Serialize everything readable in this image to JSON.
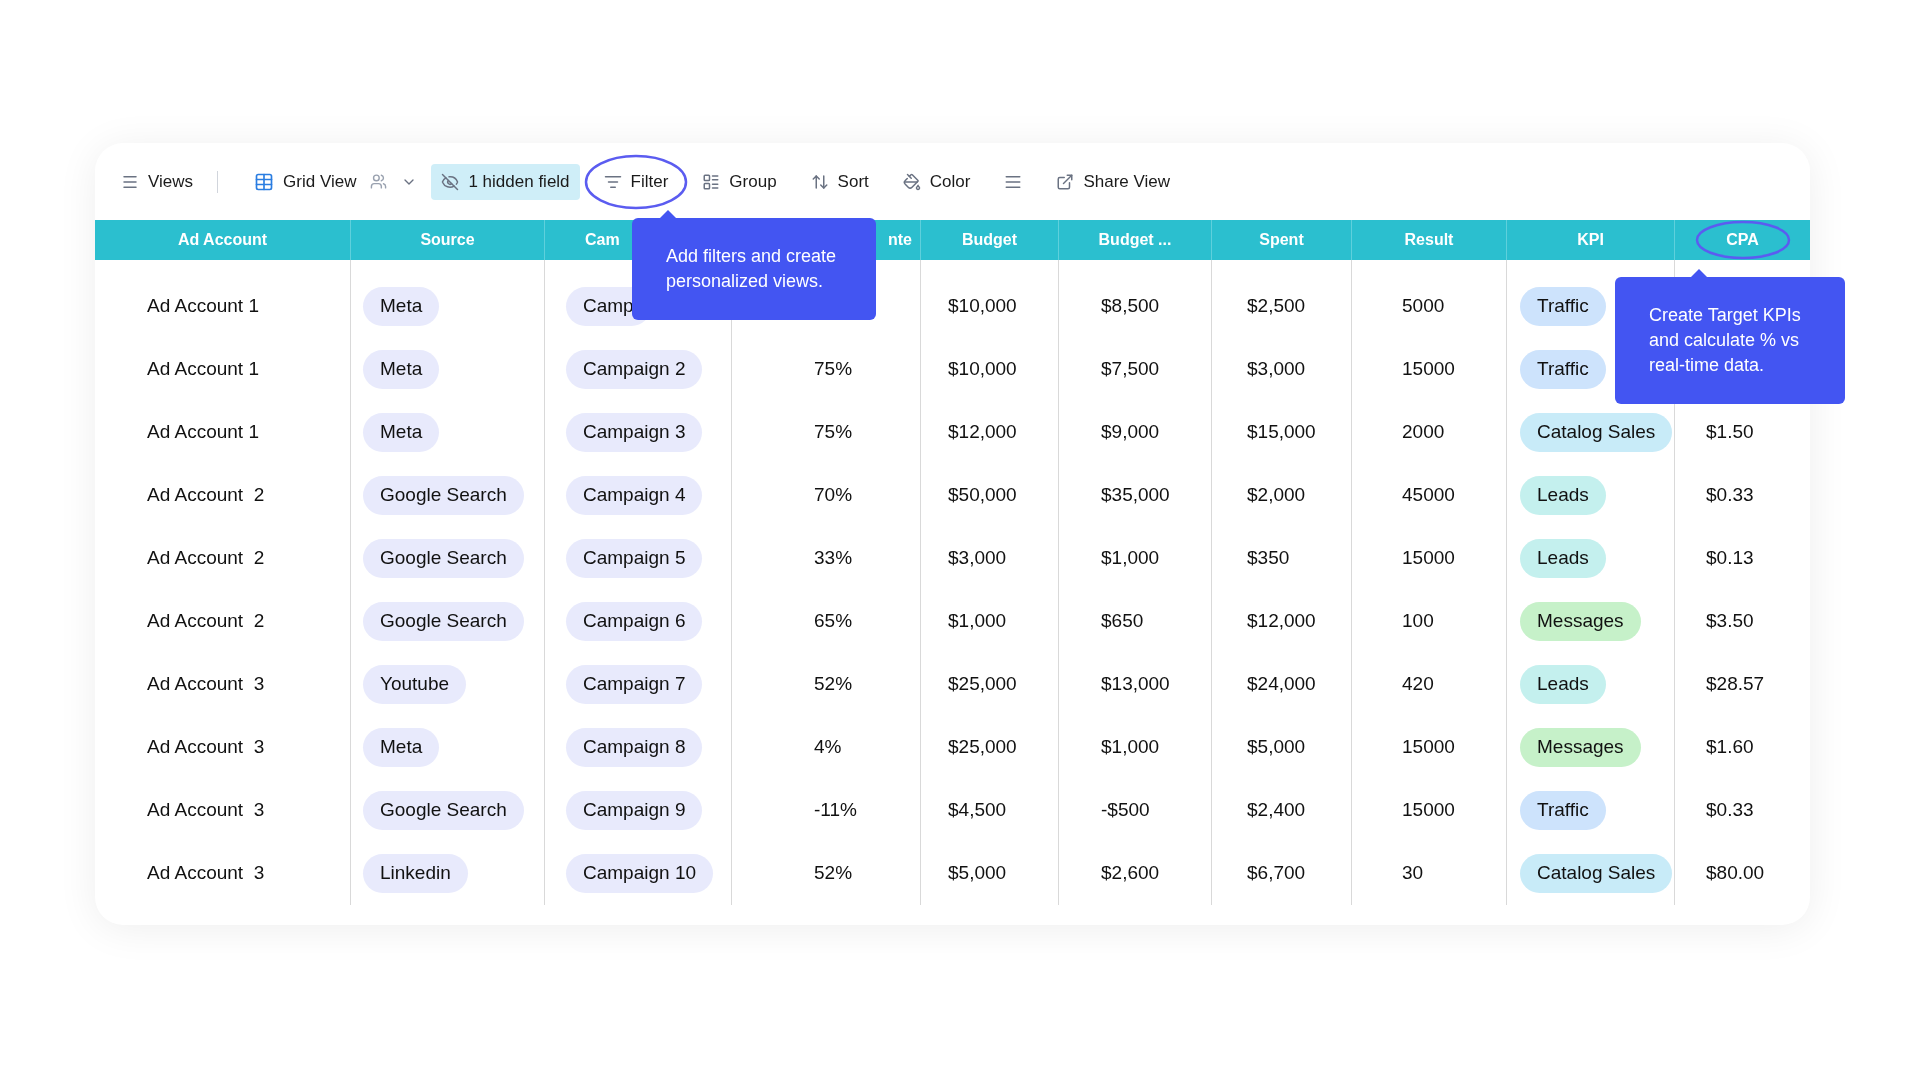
{
  "toolbar": [
    {
      "kind": "views",
      "label": "Views",
      "active": false
    },
    {
      "kind": "grid",
      "label": "Grid View",
      "active": false
    },
    {
      "kind": "hidden",
      "label": "1 hidden field",
      "active": true
    },
    {
      "kind": "filter",
      "label": "Filter",
      "active": false,
      "circled": true
    },
    {
      "kind": "group",
      "label": "Group",
      "active": false
    },
    {
      "kind": "sort",
      "label": "Sort",
      "active": false
    },
    {
      "kind": "color",
      "label": "Color",
      "active": false
    },
    {
      "kind": "rowheight",
      "active": false
    },
    {
      "kind": "share",
      "label": "Share View",
      "active": false
    }
  ],
  "table": {
    "columns": [
      {
        "label": "Ad Account"
      },
      {
        "label": "Source"
      },
      {
        "label": "Cam"
      },
      {
        "label": "nte"
      },
      {
        "label": "Budget"
      },
      {
        "label": "Budget ..."
      },
      {
        "label": "Spent"
      },
      {
        "label": "Result"
      },
      {
        "label": "KPI"
      },
      {
        "label": "CPA",
        "circled": true
      }
    ],
    "rows": [
      {
        "account": "Ad Account 1",
        "source": "Meta",
        "campaign": "Camp",
        "budget": "$10,000",
        "budget_2": "$8,500",
        "spent": "$2,500",
        "result": "5000",
        "kpi": {
          "label": "Traffic",
          "color": "#cde3fc"
        }
      },
      {
        "account": "Ad Account 1",
        "source": "Meta",
        "campaign": "Campaign 2",
        "rate": "75%",
        "budget": "$10,000",
        "budget_2": "$7,500",
        "spent": "$3,000",
        "result": "15000",
        "kpi": {
          "label": "Traffic",
          "color": "#cde3fc"
        }
      },
      {
        "account": "Ad Account 1",
        "source": "Meta",
        "campaign": "Campaign 3",
        "rate": "75%",
        "budget": "$12,000",
        "budget_2": "$9,000",
        "spent": "$15,000",
        "result": "2000",
        "kpi": {
          "label": "Catalog Sales",
          "color": "#c8ebf8"
        },
        "cpa": "$1.50"
      },
      {
        "account": "Ad Account  2",
        "source": "Google Search",
        "campaign": "Campaign 4",
        "rate": "70%",
        "budget": "$50,000",
        "budget_2": "$35,000",
        "spent": "$2,000",
        "result": "45000",
        "kpi": {
          "label": "Leads",
          "color": "#c4f0ee"
        },
        "cpa": "$0.33"
      },
      {
        "account": "Ad Account  2",
        "source": "Google Search",
        "campaign": "Campaign 5",
        "rate": "33%",
        "budget": "$3,000",
        "budget_2": "$1,000",
        "spent": "$350",
        "result": "15000",
        "kpi": {
          "label": "Leads",
          "color": "#c4f0ee"
        },
        "cpa": "$0.13"
      },
      {
        "account": "Ad Account  2",
        "source": "Google Search",
        "campaign": "Campaign 6",
        "rate": "65%",
        "budget": "$1,000",
        "budget_2": "$650",
        "spent": "$12,000",
        "result": "100",
        "kpi": {
          "label": "Messages",
          "color": "#c6f1c9"
        },
        "cpa": "$3.50"
      },
      {
        "account": "Ad Account  3",
        "source": "Youtube",
        "campaign": "Campaign 7",
        "rate": "52%",
        "budget": "$25,000",
        "budget_2": "$13,000",
        "spent": "$24,000",
        "result": "420",
        "kpi": {
          "label": "Leads",
          "color": "#c4f0ee"
        },
        "cpa": "$28.57"
      },
      {
        "account": "Ad Account  3",
        "source": "Meta",
        "campaign": "Campaign 8",
        "rate": "4%",
        "budget": "$25,000",
        "budget_2": "$1,000",
        "spent": "$5,000",
        "result": "15000",
        "kpi": {
          "label": "Messages",
          "color": "#c6f1c9"
        },
        "cpa": "$1.60"
      },
      {
        "account": "Ad Account  3",
        "source": "Google Search",
        "campaign": "Campaign 9",
        "rate": "-11%",
        "budget": "$4,500",
        "budget_2": "-$500",
        "spent": "$2,400",
        "result": "15000",
        "kpi": {
          "label": "Traffic",
          "color": "#cde3fc"
        },
        "cpa": "$0.33"
      },
      {
        "account": "Ad Account  3",
        "source": "Linkedin",
        "campaign": "Campaign 10",
        "rate": "52%",
        "budget": "$5,000",
        "budget_2": "$2,600",
        "spent": "$6,700",
        "result": "30",
        "kpi": {
          "label": "Catalog Sales",
          "color": "#c8ebf8"
        },
        "cpa": "$80.00"
      }
    ]
  },
  "tooltips": [
    {
      "kind": "filter",
      "text": "Add filters and create personalized views."
    },
    {
      "kind": "cpa",
      "text": "Create Target KPIs and calculate % vs real-time data."
    }
  ]
}
